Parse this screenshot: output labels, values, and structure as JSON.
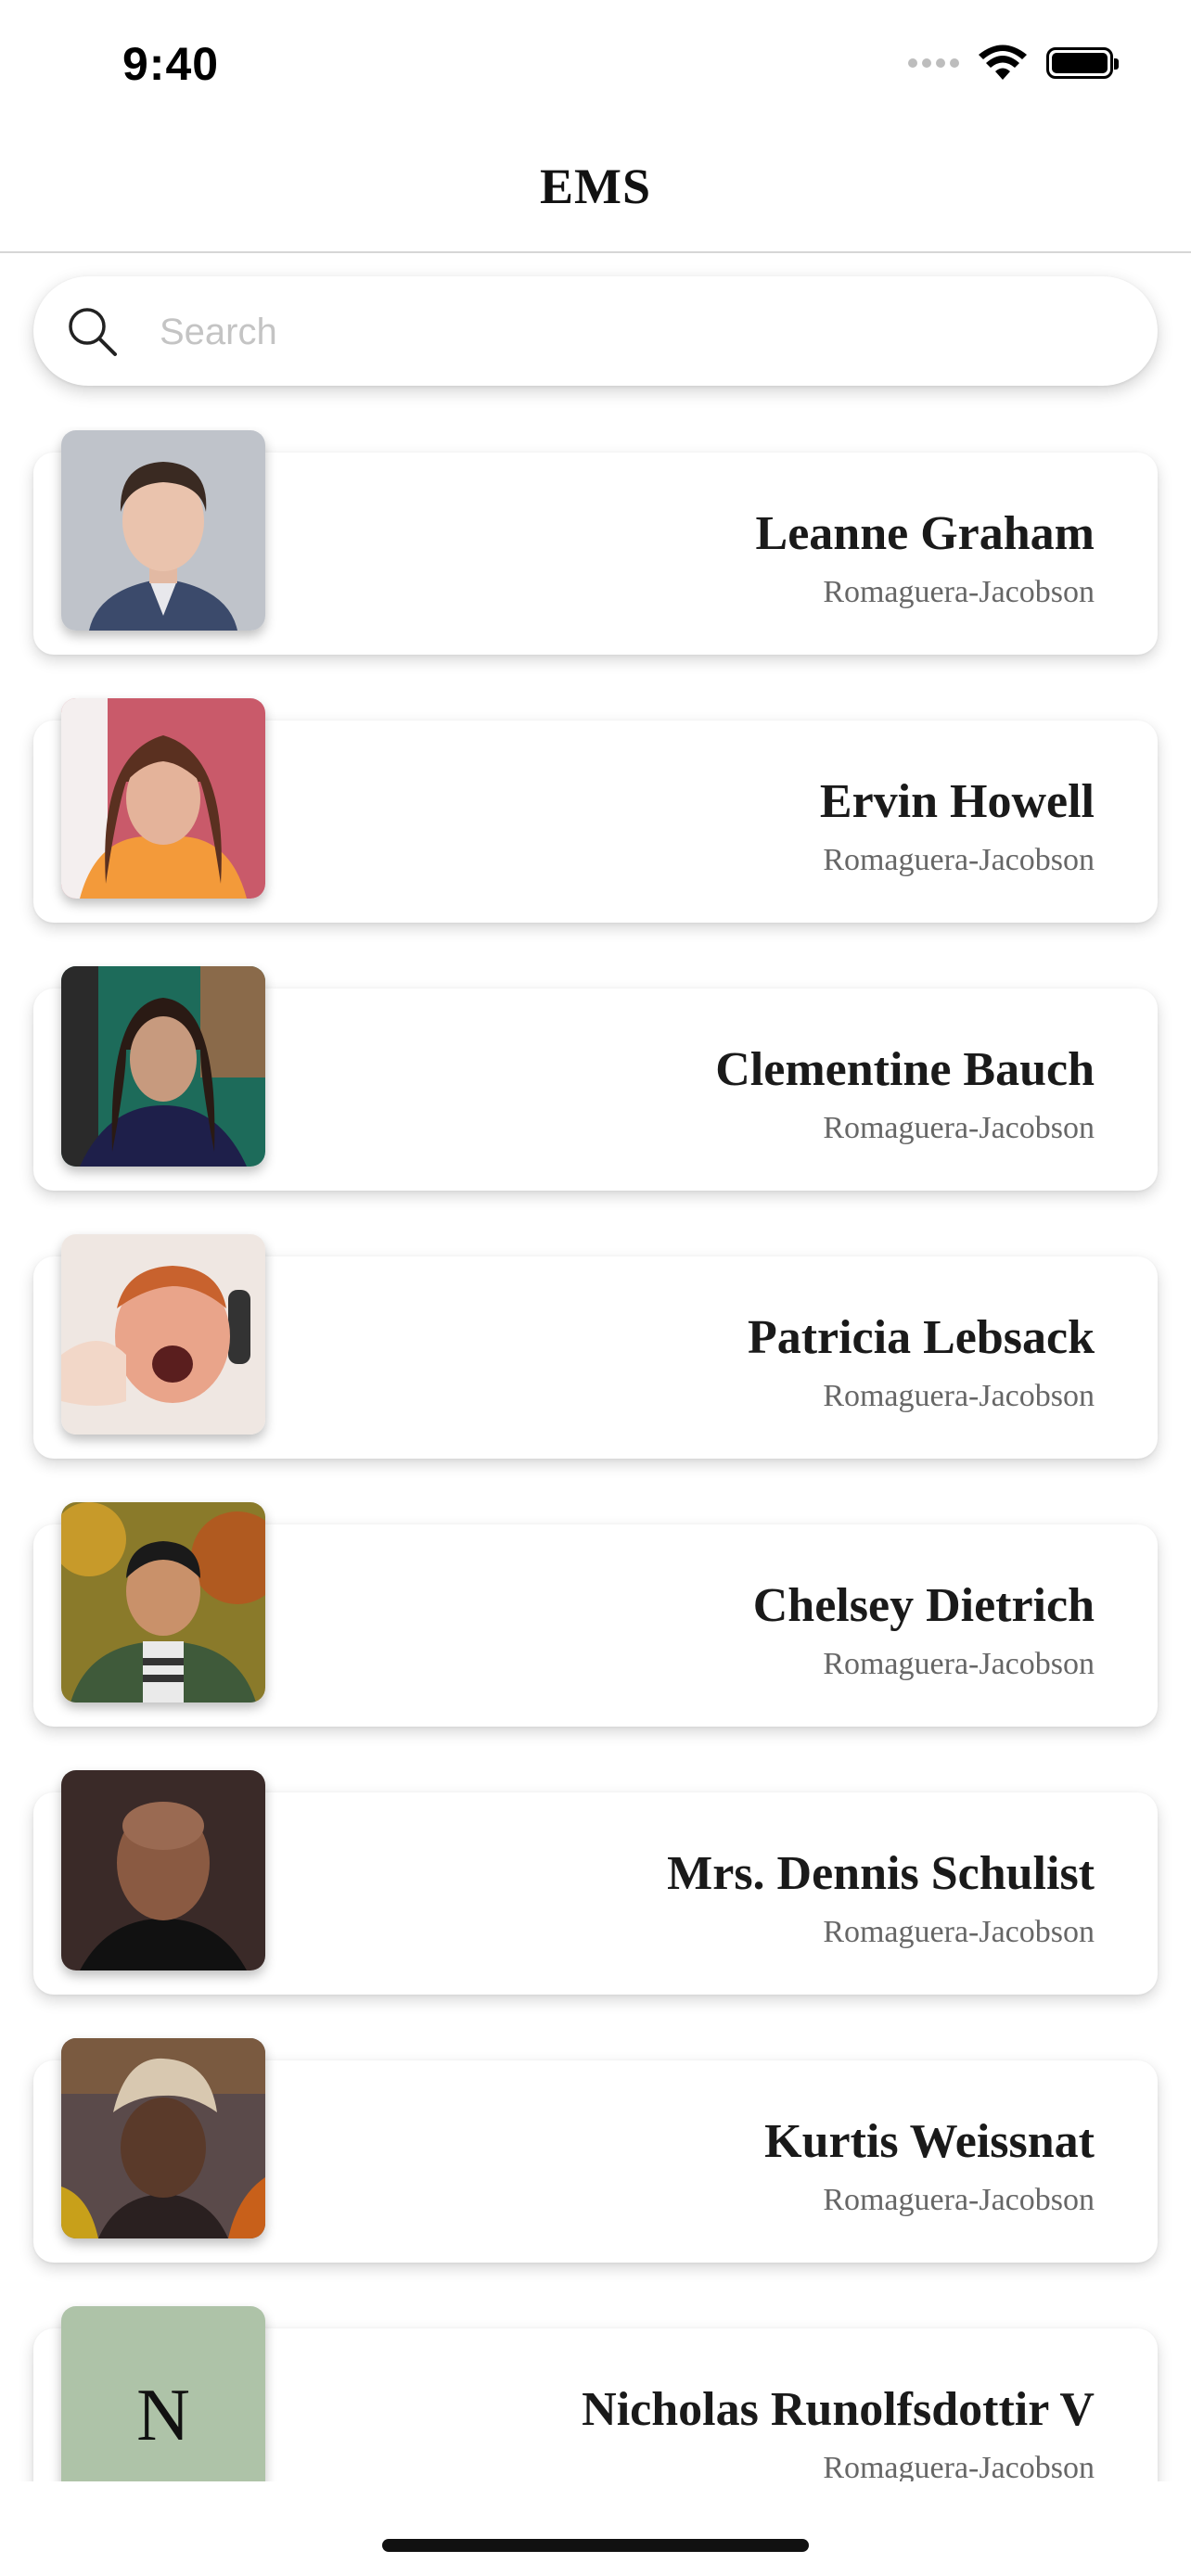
{
  "status_bar": {
    "time": "9:40"
  },
  "nav": {
    "title": "EMS"
  },
  "search": {
    "placeholder": "Search",
    "value": ""
  },
  "contacts": [
    {
      "name": "Leanne Graham",
      "company": "Romaguera-Jacobson",
      "avatar": "photo"
    },
    {
      "name": "Ervin Howell",
      "company": "Romaguera-Jacobson",
      "avatar": "photo"
    },
    {
      "name": "Clementine Bauch",
      "company": "Romaguera-Jacobson",
      "avatar": "photo"
    },
    {
      "name": "Patricia Lebsack",
      "company": "Romaguera-Jacobson",
      "avatar": "photo"
    },
    {
      "name": "Chelsey Dietrich",
      "company": "Romaguera-Jacobson",
      "avatar": "photo"
    },
    {
      "name": "Mrs. Dennis Schulist",
      "company": "Romaguera-Jacobson",
      "avatar": "photo"
    },
    {
      "name": "Kurtis Weissnat",
      "company": "Romaguera-Jacobson",
      "avatar": "photo"
    },
    {
      "name": "Nicholas Runolfsdottir V",
      "company": "Romaguera-Jacobson",
      "avatar": "initial",
      "initial": "N"
    }
  ],
  "colors": {
    "initial_avatar_bg": "#aec3a8",
    "card_bg": "#ffffff",
    "name_text": "#1a1a1a",
    "company_text": "#666666"
  }
}
